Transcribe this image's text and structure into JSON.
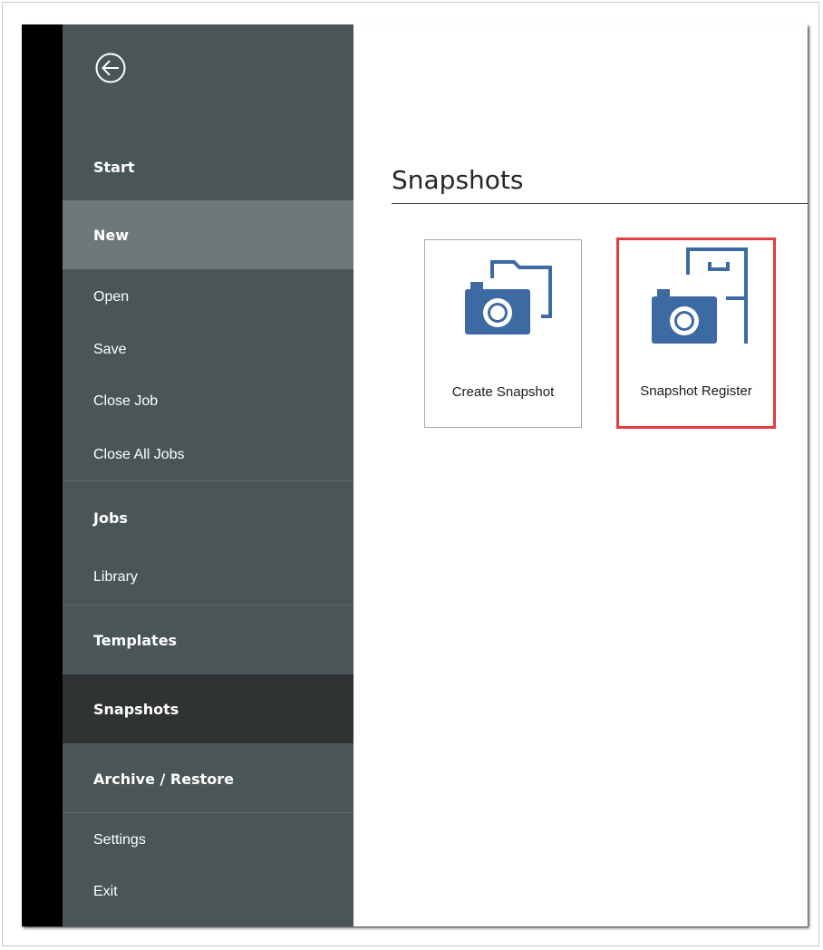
{
  "sidebar": {
    "back_icon": "circle-arrow-left-icon",
    "items": [
      {
        "label": "Start"
      },
      {
        "label": "New"
      },
      {
        "label": "Open"
      },
      {
        "label": "Save"
      },
      {
        "label": "Close Job"
      },
      {
        "label": "Close All Jobs"
      },
      {
        "label": "Jobs"
      },
      {
        "label": "Library"
      },
      {
        "label": "Templates"
      },
      {
        "label": "Snapshots"
      },
      {
        "label": "Archive / Restore"
      },
      {
        "label": "Settings"
      },
      {
        "label": "Exit"
      }
    ],
    "colors": {
      "background": "#4a5556",
      "new_highlight": "#6f7878",
      "selected": "#2f3334"
    }
  },
  "main": {
    "title": "Snapshots",
    "tiles": [
      {
        "label": "Create Snapshot",
        "icon": "camera-folder-icon"
      },
      {
        "label": "Snapshot Register",
        "icon": "camera-filing-cabinet-icon",
        "highlight_color": "#e23d43"
      }
    ],
    "icon_color": "#3d6aa3"
  }
}
